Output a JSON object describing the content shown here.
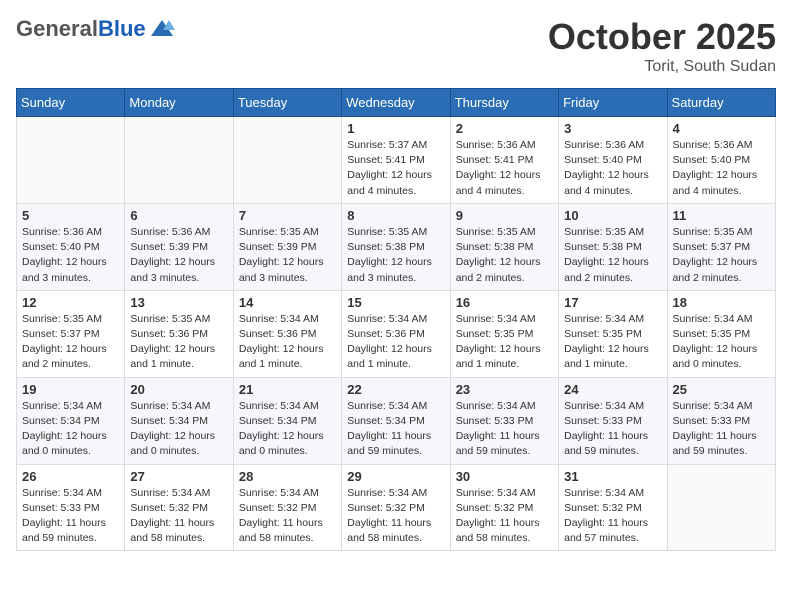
{
  "header": {
    "logo": {
      "general": "General",
      "blue": "Blue"
    },
    "month": "October 2025",
    "location": "Torit, South Sudan"
  },
  "weekdays": [
    "Sunday",
    "Monday",
    "Tuesday",
    "Wednesday",
    "Thursday",
    "Friday",
    "Saturday"
  ],
  "weeks": [
    [
      {
        "day": "",
        "content": ""
      },
      {
        "day": "",
        "content": ""
      },
      {
        "day": "",
        "content": ""
      },
      {
        "day": "1",
        "content": "Sunrise: 5:37 AM\nSunset: 5:41 PM\nDaylight: 12 hours\nand 4 minutes."
      },
      {
        "day": "2",
        "content": "Sunrise: 5:36 AM\nSunset: 5:41 PM\nDaylight: 12 hours\nand 4 minutes."
      },
      {
        "day": "3",
        "content": "Sunrise: 5:36 AM\nSunset: 5:40 PM\nDaylight: 12 hours\nand 4 minutes."
      },
      {
        "day": "4",
        "content": "Sunrise: 5:36 AM\nSunset: 5:40 PM\nDaylight: 12 hours\nand 4 minutes."
      }
    ],
    [
      {
        "day": "5",
        "content": "Sunrise: 5:36 AM\nSunset: 5:40 PM\nDaylight: 12 hours\nand 3 minutes."
      },
      {
        "day": "6",
        "content": "Sunrise: 5:36 AM\nSunset: 5:39 PM\nDaylight: 12 hours\nand 3 minutes."
      },
      {
        "day": "7",
        "content": "Sunrise: 5:35 AM\nSunset: 5:39 PM\nDaylight: 12 hours\nand 3 minutes."
      },
      {
        "day": "8",
        "content": "Sunrise: 5:35 AM\nSunset: 5:38 PM\nDaylight: 12 hours\nand 3 minutes."
      },
      {
        "day": "9",
        "content": "Sunrise: 5:35 AM\nSunset: 5:38 PM\nDaylight: 12 hours\nand 2 minutes."
      },
      {
        "day": "10",
        "content": "Sunrise: 5:35 AM\nSunset: 5:38 PM\nDaylight: 12 hours\nand 2 minutes."
      },
      {
        "day": "11",
        "content": "Sunrise: 5:35 AM\nSunset: 5:37 PM\nDaylight: 12 hours\nand 2 minutes."
      }
    ],
    [
      {
        "day": "12",
        "content": "Sunrise: 5:35 AM\nSunset: 5:37 PM\nDaylight: 12 hours\nand 2 minutes."
      },
      {
        "day": "13",
        "content": "Sunrise: 5:35 AM\nSunset: 5:36 PM\nDaylight: 12 hours\nand 1 minute."
      },
      {
        "day": "14",
        "content": "Sunrise: 5:34 AM\nSunset: 5:36 PM\nDaylight: 12 hours\nand 1 minute."
      },
      {
        "day": "15",
        "content": "Sunrise: 5:34 AM\nSunset: 5:36 PM\nDaylight: 12 hours\nand 1 minute."
      },
      {
        "day": "16",
        "content": "Sunrise: 5:34 AM\nSunset: 5:35 PM\nDaylight: 12 hours\nand 1 minute."
      },
      {
        "day": "17",
        "content": "Sunrise: 5:34 AM\nSunset: 5:35 PM\nDaylight: 12 hours\nand 1 minute."
      },
      {
        "day": "18",
        "content": "Sunrise: 5:34 AM\nSunset: 5:35 PM\nDaylight: 12 hours\nand 0 minutes."
      }
    ],
    [
      {
        "day": "19",
        "content": "Sunrise: 5:34 AM\nSunset: 5:34 PM\nDaylight: 12 hours\nand 0 minutes."
      },
      {
        "day": "20",
        "content": "Sunrise: 5:34 AM\nSunset: 5:34 PM\nDaylight: 12 hours\nand 0 minutes."
      },
      {
        "day": "21",
        "content": "Sunrise: 5:34 AM\nSunset: 5:34 PM\nDaylight: 12 hours\nand 0 minutes."
      },
      {
        "day": "22",
        "content": "Sunrise: 5:34 AM\nSunset: 5:34 PM\nDaylight: 11 hours\nand 59 minutes."
      },
      {
        "day": "23",
        "content": "Sunrise: 5:34 AM\nSunset: 5:33 PM\nDaylight: 11 hours\nand 59 minutes."
      },
      {
        "day": "24",
        "content": "Sunrise: 5:34 AM\nSunset: 5:33 PM\nDaylight: 11 hours\nand 59 minutes."
      },
      {
        "day": "25",
        "content": "Sunrise: 5:34 AM\nSunset: 5:33 PM\nDaylight: 11 hours\nand 59 minutes."
      }
    ],
    [
      {
        "day": "26",
        "content": "Sunrise: 5:34 AM\nSunset: 5:33 PM\nDaylight: 11 hours\nand 59 minutes."
      },
      {
        "day": "27",
        "content": "Sunrise: 5:34 AM\nSunset: 5:32 PM\nDaylight: 11 hours\nand 58 minutes."
      },
      {
        "day": "28",
        "content": "Sunrise: 5:34 AM\nSunset: 5:32 PM\nDaylight: 11 hours\nand 58 minutes."
      },
      {
        "day": "29",
        "content": "Sunrise: 5:34 AM\nSunset: 5:32 PM\nDaylight: 11 hours\nand 58 minutes."
      },
      {
        "day": "30",
        "content": "Sunrise: 5:34 AM\nSunset: 5:32 PM\nDaylight: 11 hours\nand 58 minutes."
      },
      {
        "day": "31",
        "content": "Sunrise: 5:34 AM\nSunset: 5:32 PM\nDaylight: 11 hours\nand 57 minutes."
      },
      {
        "day": "",
        "content": ""
      }
    ]
  ]
}
